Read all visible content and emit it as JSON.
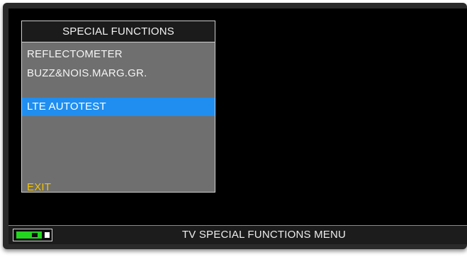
{
  "menu": {
    "title": "SPECIAL FUNCTIONS",
    "items": [
      {
        "label": "REFLECTOMETER",
        "selected": false
      },
      {
        "label": "BUZZ&NOIS.MARG.GR.",
        "selected": false
      },
      {
        "label": "LTE AUTOTEST",
        "selected": true
      }
    ],
    "exit_label": "EXIT"
  },
  "status_bar": {
    "text": "TV SPECIAL FUNCTIONS MENU",
    "battery_icon": "battery-charging-icon"
  },
  "colors": {
    "screen_background": "#000000",
    "menu_background": "#6f6f6f",
    "selected_highlight": "#1f8ef0",
    "exit_text": "#f2c300",
    "battery_fill": "#23d51f"
  }
}
